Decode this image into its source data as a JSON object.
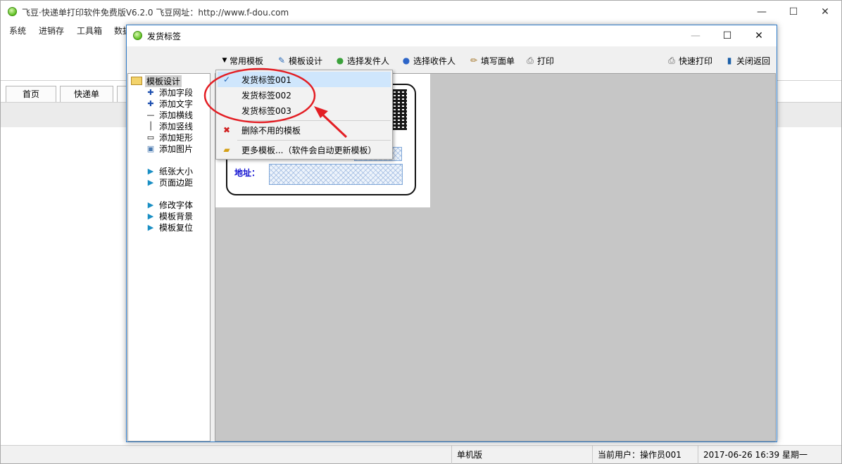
{
  "main_window": {
    "title": "飞豆·快递单打印软件免费版V6.2.0   飞豆网址：http://www.f-dou.com",
    "controls": {
      "minimize": "—",
      "maximize": "☐",
      "close": "✕"
    },
    "menu": [
      "系统",
      "进销存",
      "工具箱",
      "数据"
    ],
    "tabs": [
      "首页",
      "快递单"
    ]
  },
  "dialog": {
    "title": "发货标签",
    "controls": {
      "minimize": "—",
      "maximize": "☐",
      "close": "✕"
    },
    "toolbar": {
      "common_templates": "常用模板",
      "template_design": "模板设计",
      "select_sender": "选择发件人",
      "select_receiver": "选择收件人",
      "fill_form": "填写面单",
      "print": "打印",
      "quick_print": "快速打印",
      "close_return": "关闭返回"
    },
    "sidebar": {
      "root": "模板设计",
      "items": [
        "添加字段",
        "添加文字",
        "添加横线",
        "添加竖线",
        "添加矩形",
        "添加图片",
        "纸张大小",
        "页面边距",
        "修改字体",
        "模板背景",
        "模板复位"
      ]
    },
    "canvas": {
      "address_label": "地址："
    },
    "dropdown": {
      "templates": [
        "发货标签001",
        "发货标签002",
        "发货标签003"
      ],
      "selected_index": 0,
      "delete_unused": "删除不用的模板",
      "more_templates": "更多模板...（软件会自动更新模板）"
    }
  },
  "statusbar": {
    "edition": "单机版",
    "current_user": "当前用户：操作员001",
    "datetime": "2017-06-26 16:39 星期一"
  },
  "colors": {
    "accent_blue": "#2b79c8",
    "annotation_red": "#e31e24",
    "address_label": "#1010d0"
  },
  "icons": {
    "app": "green-circle-icon",
    "template_design": "pencil-ruler-icon",
    "sender": "green-person-icon",
    "receiver": "blue-person-icon",
    "fill_form": "pencil-icon",
    "print": "printer-icon",
    "quick_print": "printer-icon",
    "close_return": "exit-door-icon",
    "checked": "checkmark-icon",
    "delete": "red-x-icon",
    "more": "folder-icon"
  }
}
